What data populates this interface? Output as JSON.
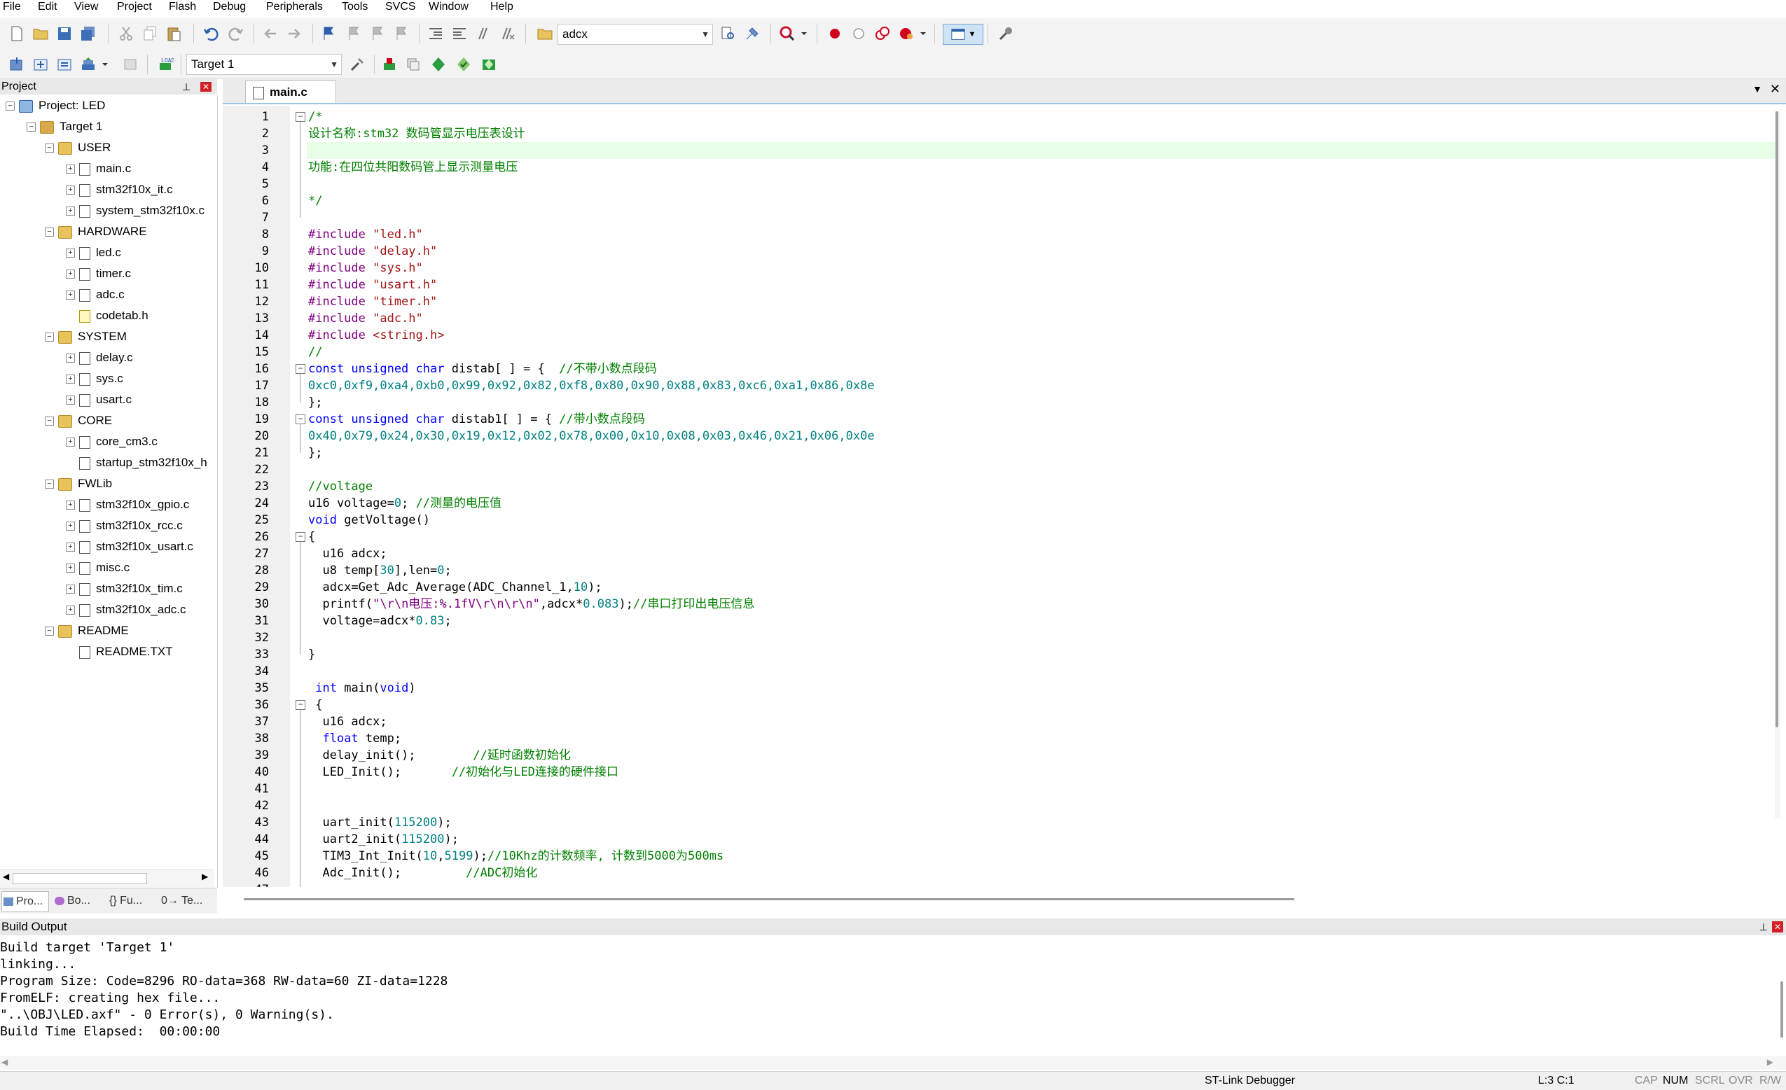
{
  "menu": [
    "File",
    "Edit",
    "View",
    "Project",
    "Flash",
    "Debug",
    "Peripherals",
    "Tools",
    "SVCS",
    "Window",
    "Help"
  ],
  "toolbar": {
    "find_value": "adcx",
    "target_value": "Target 1"
  },
  "project_panel": {
    "title": "Project",
    "tree": [
      {
        "label": "Project: LED",
        "level": 0,
        "type": "project",
        "expander": "−"
      },
      {
        "label": "Target 1",
        "level": 1,
        "type": "target",
        "expander": "−"
      },
      {
        "label": "USER",
        "level": 2,
        "type": "folder",
        "expander": "−"
      },
      {
        "label": "main.c",
        "level": 3,
        "type": "file",
        "expander": "+"
      },
      {
        "label": "stm32f10x_it.c",
        "level": 3,
        "type": "file",
        "expander": "+"
      },
      {
        "label": "system_stm32f10x.c",
        "level": 3,
        "type": "file",
        "expander": "+"
      },
      {
        "label": "HARDWARE",
        "level": 2,
        "type": "folder",
        "expander": "−"
      },
      {
        "label": "led.c",
        "level": 3,
        "type": "file",
        "expander": "+"
      },
      {
        "label": "timer.c",
        "level": 3,
        "type": "file",
        "expander": "+"
      },
      {
        "label": "adc.c",
        "level": 3,
        "type": "file",
        "expander": "+"
      },
      {
        "label": "codetab.h",
        "level": 3,
        "type": "hfile",
        "expander": ""
      },
      {
        "label": "SYSTEM",
        "level": 2,
        "type": "folder",
        "expander": "−"
      },
      {
        "label": "delay.c",
        "level": 3,
        "type": "file",
        "expander": "+"
      },
      {
        "label": "sys.c",
        "level": 3,
        "type": "file",
        "expander": "+"
      },
      {
        "label": "usart.c",
        "level": 3,
        "type": "file",
        "expander": "+"
      },
      {
        "label": "CORE",
        "level": 2,
        "type": "folder",
        "expander": "−"
      },
      {
        "label": "core_cm3.c",
        "level": 3,
        "type": "file",
        "expander": "+"
      },
      {
        "label": "startup_stm32f10x_h",
        "level": 3,
        "type": "file",
        "expander": ""
      },
      {
        "label": "FWLib",
        "level": 2,
        "type": "folder",
        "expander": "−"
      },
      {
        "label": "stm32f10x_gpio.c",
        "level": 3,
        "type": "file",
        "expander": "+"
      },
      {
        "label": "stm32f10x_rcc.c",
        "level": 3,
        "type": "file",
        "expander": "+"
      },
      {
        "label": "stm32f10x_usart.c",
        "level": 3,
        "type": "file",
        "expander": "+"
      },
      {
        "label": "misc.c",
        "level": 3,
        "type": "file",
        "expander": "+"
      },
      {
        "label": "stm32f10x_tim.c",
        "level": 3,
        "type": "file",
        "expander": "+"
      },
      {
        "label": "stm32f10x_adc.c",
        "level": 3,
        "type": "file",
        "expander": "+"
      },
      {
        "label": "README",
        "level": 2,
        "type": "folder",
        "expander": "−"
      },
      {
        "label": "README.TXT",
        "level": 3,
        "type": "file",
        "expander": ""
      }
    ],
    "bottom_tabs": [
      "Pro...",
      "Bo...",
      "{} Fu...",
      "0→ Te..."
    ]
  },
  "editor": {
    "tab_label": "main.c",
    "highlighted_line": 3,
    "lines": [
      [
        [
          "cm",
          "/*"
        ]
      ],
      [
        [
          "cm",
          "设计名称:stm32 数码管显示电压表设计"
        ]
      ],
      [],
      [
        [
          "cm",
          "功能:在四位共阳数码管上显示测量电压"
        ]
      ],
      [],
      [
        [
          "cm",
          "*/"
        ]
      ],
      [],
      [
        [
          "pp",
          "#include "
        ],
        [
          "str",
          "\"led.h\""
        ]
      ],
      [
        [
          "pp",
          "#include "
        ],
        [
          "str",
          "\"delay.h\""
        ]
      ],
      [
        [
          "pp",
          "#include "
        ],
        [
          "str",
          "\"sys.h\""
        ]
      ],
      [
        [
          "pp",
          "#include "
        ],
        [
          "str",
          "\"usart.h\""
        ]
      ],
      [
        [
          "pp",
          "#include "
        ],
        [
          "str",
          "\"timer.h\""
        ]
      ],
      [
        [
          "pp",
          "#include "
        ],
        [
          "str",
          "\"adc.h\""
        ]
      ],
      [
        [
          "pp",
          "#include "
        ],
        [
          "str",
          "<string.h>"
        ]
      ],
      [
        [
          "cm",
          "//"
        ]
      ],
      [
        [
          "kw",
          "const unsigned char"
        ],
        [
          "tx",
          " distab[ ] = {  "
        ],
        [
          "cm",
          "//不带小数点段码"
        ]
      ],
      [
        [
          "num",
          "0xc0,0xf9,0xa4,0xb0,0x99,0x92,0x82,0xf8,0x80,0x90,0x88,0x83,0xc6,0xa1,0x86,0x8e"
        ]
      ],
      [
        [
          "tx",
          "};"
        ]
      ],
      [
        [
          "kw",
          "const unsigned char"
        ],
        [
          "tx",
          " distab1[ ] = { "
        ],
        [
          "cm",
          "//带小数点段码"
        ]
      ],
      [
        [
          "num",
          "0x40,0x79,0x24,0x30,0x19,0x12,0x02,0x78,0x00,0x10,0x08,0x03,0x46,0x21,0x06,0x0e"
        ]
      ],
      [
        [
          "tx",
          "};"
        ]
      ],
      [],
      [
        [
          "cm",
          "//voltage"
        ]
      ],
      [
        [
          "tx",
          "u16 voltage="
        ],
        [
          "num",
          "0"
        ],
        [
          "tx",
          "; "
        ],
        [
          "cm",
          "//测量的电压值"
        ]
      ],
      [
        [
          "kw",
          "void"
        ],
        [
          "tx",
          " getVoltage()"
        ]
      ],
      [
        [
          "tx",
          "{"
        ]
      ],
      [
        [
          "tx",
          "  u16 adcx;"
        ]
      ],
      [
        [
          "tx",
          "  u8 temp["
        ],
        [
          "num",
          "30"
        ],
        [
          "tx",
          "],len="
        ],
        [
          "num",
          "0"
        ],
        [
          "tx",
          ";"
        ]
      ],
      [
        [
          "tx",
          "  adcx=Get_Adc_Average(ADC_Channel_1,"
        ],
        [
          "num",
          "10"
        ],
        [
          "tx",
          ");"
        ]
      ],
      [
        [
          "tx",
          "  printf("
        ],
        [
          "pp",
          "\"\\r\\n电压:%.1fV\\r\\n\\r\\n\""
        ],
        [
          "tx",
          ",adcx*"
        ],
        [
          "num",
          "0.083"
        ],
        [
          "tx",
          ");"
        ],
        [
          "cm",
          "//串口打印出电压信息"
        ]
      ],
      [
        [
          "tx",
          "  voltage=adcx*"
        ],
        [
          "num",
          "0.83"
        ],
        [
          "tx",
          ";"
        ]
      ],
      [],
      [
        [
          "tx",
          "}"
        ]
      ],
      [],
      [
        [
          "tx",
          " "
        ],
        [
          "kw",
          "int"
        ],
        [
          "tx",
          " main("
        ],
        [
          "kw",
          "void"
        ],
        [
          "tx",
          ")"
        ]
      ],
      [
        [
          "tx",
          " {"
        ]
      ],
      [
        [
          "tx",
          "  u16 adcx;"
        ]
      ],
      [
        [
          "tx",
          "  "
        ],
        [
          "kw",
          "float"
        ],
        [
          "tx",
          " temp;"
        ]
      ],
      [
        [
          "tx",
          "  delay_init();        "
        ],
        [
          "cm",
          "//延时函数初始化"
        ]
      ],
      [
        [
          "tx",
          "  LED_Init();       "
        ],
        [
          "cm",
          "//初始化与LED连接的硬件接口"
        ]
      ],
      [],
      [],
      [
        [
          "tx",
          "  uart_init("
        ],
        [
          "num",
          "115200"
        ],
        [
          "tx",
          ");"
        ]
      ],
      [
        [
          "tx",
          "  uart2_init("
        ],
        [
          "num",
          "115200"
        ],
        [
          "tx",
          ");"
        ]
      ],
      [
        [
          "tx",
          "  TIM3_Int_Init("
        ],
        [
          "num",
          "10"
        ],
        [
          "tx",
          ","
        ],
        [
          "num",
          "5199"
        ],
        [
          "tx",
          ");"
        ],
        [
          "cm",
          "//10Khz的计数频率, 计数到5000为500ms"
        ]
      ],
      [
        [
          "tx",
          "  Adc_Init();         "
        ],
        [
          "cm",
          "//ADC初始化"
        ]
      ],
      []
    ]
  },
  "build_output": {
    "title": "Build Output",
    "lines": [
      "Build target 'Target 1'",
      "linking...",
      "Program Size: Code=8296 RO-data=368 RW-data=60 ZI-data=1228",
      "FromELF: creating hex file...",
      "\"..\\OBJ\\LED.axf\" - 0 Error(s), 0 Warning(s).",
      "Build Time Elapsed:  00:00:00"
    ]
  },
  "status": {
    "debugger": "ST-Link Debugger",
    "position": "L:3 C:1",
    "cap": "CAP",
    "num": "NUM",
    "scrl": "SCRL",
    "ovr": "OVR",
    "rw": "R/W"
  }
}
